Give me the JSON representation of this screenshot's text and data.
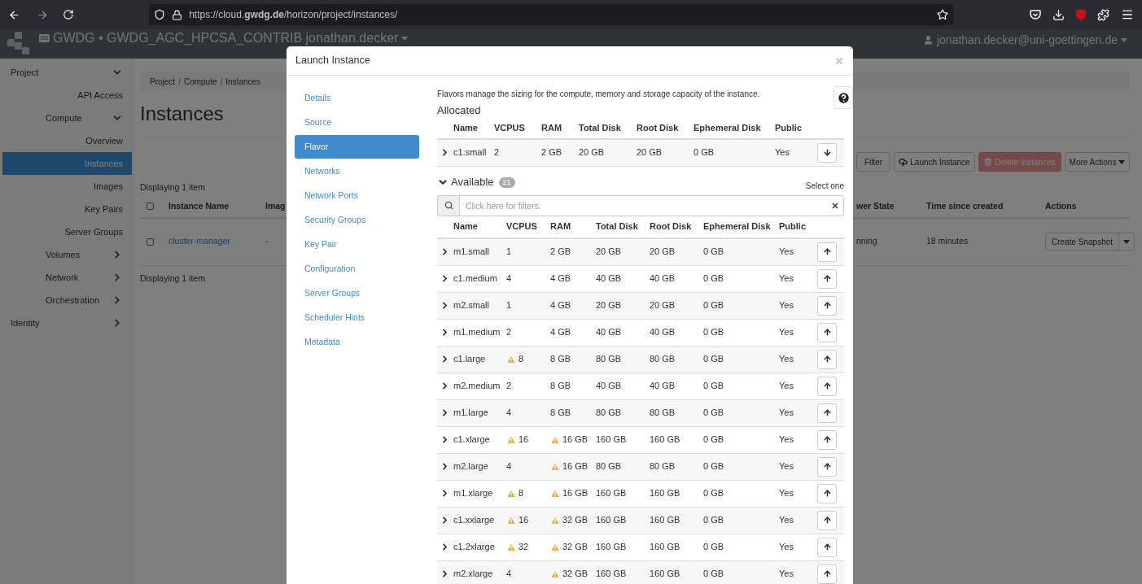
{
  "browser": {
    "url": "https://cloud.**gwdg.de**/horizon/project/instances/"
  },
  "header": {
    "project": "GWDG • GWDG_AGC_HPCSA_CONTRIB jonathan.decker",
    "user": "jonathan.decker@uni-goettingen.de"
  },
  "sidebar": {
    "items": [
      {
        "label": "Project",
        "expanded": true,
        "children": [
          {
            "label": "API Access",
            "selected": false
          },
          {
            "label": "Compute",
            "expanded": true,
            "children": [
              {
                "label": "Overview",
                "selected": false
              },
              {
                "label": "Instances",
                "selected": true
              },
              {
                "label": "Images",
                "selected": false
              },
              {
                "label": "Key Pairs",
                "selected": false
              },
              {
                "label": "Server Groups",
                "selected": false
              }
            ]
          },
          {
            "label": "Volumes",
            "expanded": false
          },
          {
            "label": "Network",
            "expanded": false
          },
          {
            "label": "Orchestration",
            "expanded": false
          }
        ]
      },
      {
        "label": "Identity",
        "expanded": false
      }
    ]
  },
  "page": {
    "breadcrumb": [
      {
        "label": "Project",
        "separator": "/"
      },
      {
        "label": "Compute",
        "separator": "/"
      },
      {
        "label": "Instances"
      }
    ],
    "title": "Instances",
    "count_top": "Displaying 1 item",
    "count_bottom": "Displaying 1 item",
    "buttons": [
      {
        "label": "Filter",
        "kind": "plain",
        "disabled": false
      },
      {
        "label": "Launch Instance",
        "kind": "launch",
        "disabled": false
      },
      {
        "label": "Delete Instances",
        "kind": "delete",
        "disabled": true
      },
      {
        "label": "More Actions",
        "kind": "menu",
        "disabled": false
      }
    ],
    "select_all_checked": false,
    "columns": [
      "Instance Name",
      "Imag",
      "wer State",
      "Time since created",
      "Actions"
    ],
    "rows": [
      {
        "checked": false,
        "name": "cluster-manager",
        "image": "-",
        "power_state": "nning",
        "time": "18 minutes",
        "action": "Create Snapshot"
      }
    ]
  },
  "modal": {
    "title": "Launch Instance",
    "steps": [
      {
        "label": "Details",
        "selected": false
      },
      {
        "label": "Source",
        "selected": false
      },
      {
        "label": "Flavor",
        "selected": true
      },
      {
        "label": "Networks",
        "selected": false
      },
      {
        "label": "Network Ports",
        "selected": false
      },
      {
        "label": "Security Groups",
        "selected": false
      },
      {
        "label": "Key Pair",
        "selected": false
      },
      {
        "label": "Configuration",
        "selected": false
      },
      {
        "label": "Server Groups",
        "selected": false
      },
      {
        "label": "Scheduler Hints",
        "selected": false
      },
      {
        "label": "Metadata",
        "selected": false
      }
    ],
    "description": "Flavors manage the sizing for the compute, memory and storage capacity of the instance.",
    "allocated_title": "Allocated",
    "allocated_columns": [
      "Name",
      "VCPUS",
      "RAM",
      "Total Disk",
      "Root Disk",
      "Ephemeral Disk",
      "Public"
    ],
    "allocated": [
      {
        "name": "c1.small",
        "vcpus": "2",
        "vcpus_warning": false,
        "ram": "2 GB",
        "ram_warning": false,
        "total_disk": "20 GB",
        "root_disk": "20 GB",
        "ephemeral_disk": "0 GB",
        "public": "Yes"
      }
    ],
    "available_title": "Available",
    "available_count": "21",
    "available_expanded": true,
    "select_hint": "Select one",
    "filter_placeholder": "Click here for filters.",
    "available_columns": [
      "Name",
      "VCPUS",
      "RAM",
      "Total Disk",
      "Root Disk",
      "Ephemeral Disk",
      "Public"
    ],
    "available": [
      {
        "name": "m1.small",
        "vcpus": "1",
        "vcpus_warning": false,
        "ram": "2 GB",
        "ram_warning": false,
        "total_disk": "20 GB",
        "root_disk": "20 GB",
        "ephemeral_disk": "0 GB",
        "public": "Yes"
      },
      {
        "name": "c1.medium",
        "vcpus": "4",
        "vcpus_warning": false,
        "ram": "4 GB",
        "ram_warning": false,
        "total_disk": "40 GB",
        "root_disk": "40 GB",
        "ephemeral_disk": "0 GB",
        "public": "Yes"
      },
      {
        "name": "m2.small",
        "vcpus": "1",
        "vcpus_warning": false,
        "ram": "4 GB",
        "ram_warning": false,
        "total_disk": "20 GB",
        "root_disk": "20 GB",
        "ephemeral_disk": "0 GB",
        "public": "Yes"
      },
      {
        "name": "m1.medium",
        "vcpus": "2",
        "vcpus_warning": false,
        "ram": "4 GB",
        "ram_warning": false,
        "total_disk": "40 GB",
        "root_disk": "40 GB",
        "ephemeral_disk": "0 GB",
        "public": "Yes"
      },
      {
        "name": "c1.large",
        "vcpus": "8",
        "vcpus_warning": true,
        "ram": "8 GB",
        "ram_warning": false,
        "total_disk": "80 GB",
        "root_disk": "80 GB",
        "ephemeral_disk": "0 GB",
        "public": "Yes"
      },
      {
        "name": "m2.medium",
        "vcpus": "2",
        "vcpus_warning": false,
        "ram": "8 GB",
        "ram_warning": false,
        "total_disk": "40 GB",
        "root_disk": "40 GB",
        "ephemeral_disk": "0 GB",
        "public": "Yes"
      },
      {
        "name": "m1.large",
        "vcpus": "4",
        "vcpus_warning": false,
        "ram": "8 GB",
        "ram_warning": false,
        "total_disk": "80 GB",
        "root_disk": "80 GB",
        "ephemeral_disk": "0 GB",
        "public": "Yes"
      },
      {
        "name": "c1.xlarge",
        "vcpus": "16",
        "vcpus_warning": true,
        "ram": "16 GB",
        "ram_warning": true,
        "total_disk": "160 GB",
        "root_disk": "160 GB",
        "ephemeral_disk": "0 GB",
        "public": "Yes"
      },
      {
        "name": "m2.large",
        "vcpus": "4",
        "vcpus_warning": false,
        "ram": "16 GB",
        "ram_warning": true,
        "total_disk": "80 GB",
        "root_disk": "80 GB",
        "ephemeral_disk": "0 GB",
        "public": "Yes"
      },
      {
        "name": "m1.xlarge",
        "vcpus": "8",
        "vcpus_warning": true,
        "ram": "16 GB",
        "ram_warning": true,
        "total_disk": "160 GB",
        "root_disk": "160 GB",
        "ephemeral_disk": "0 GB",
        "public": "Yes"
      },
      {
        "name": "c1.xxlarge",
        "vcpus": "16",
        "vcpus_warning": true,
        "ram": "32 GB",
        "ram_warning": true,
        "total_disk": "160 GB",
        "root_disk": "160 GB",
        "ephemeral_disk": "0 GB",
        "public": "Yes"
      },
      {
        "name": "c1.2xlarge",
        "vcpus": "32",
        "vcpus_warning": true,
        "ram": "32 GB",
        "ram_warning": true,
        "total_disk": "160 GB",
        "root_disk": "160 GB",
        "ephemeral_disk": "0 GB",
        "public": "Yes"
      },
      {
        "name": "m2.xlarge",
        "vcpus": "4",
        "vcpus_warning": false,
        "ram": "32 GB",
        "ram_warning": true,
        "total_disk": "160 GB",
        "root_disk": "160 GB",
        "ephemeral_disk": "0 GB",
        "public": "Yes"
      }
    ]
  }
}
